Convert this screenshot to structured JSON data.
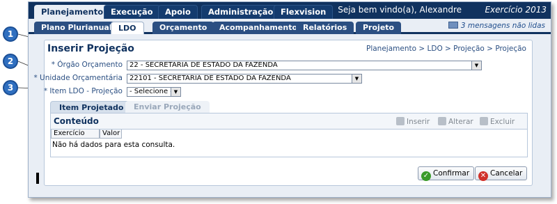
{
  "top_tabs": [
    {
      "label": "Planejamento"
    },
    {
      "label": "Execução"
    },
    {
      "label": "Apoio"
    },
    {
      "label": "Administração"
    },
    {
      "label": "Flexvision"
    }
  ],
  "welcome_text": "Seja bem vindo(a), Alexandre",
  "exercise_text": "Exercício 2013",
  "sub_tabs": [
    {
      "label": "Plano Plurianual"
    },
    {
      "label": "LDO"
    },
    {
      "label": "Orçamento"
    },
    {
      "label": "Acompanhamento"
    },
    {
      "label": "Relatórios"
    },
    {
      "label": "Projeto"
    }
  ],
  "messages_text": "3 mensagens não lidas",
  "panel": {
    "title": "Inserir Projeção",
    "breadcrumb": "Planejamento > LDO > Projeção > Projeção"
  },
  "form": {
    "orgao_label": "* Órgão Orçamento",
    "orgao_value": "22 - SECRETARIA DE ESTADO DA FAZENDA",
    "unidade_label": "* Unidade Orçamentária",
    "unidade_value": "22101 - SECRETARIA DE ESTADO DA FAZENDA",
    "item_label": "* Item LDO - Projeção",
    "item_value": "- Selecione -"
  },
  "inner_tabs": [
    {
      "label": "Item Projetado"
    },
    {
      "label": "Enviar Projeção"
    }
  ],
  "content": {
    "title": "Conteúdo",
    "insert_label": "Inserir",
    "edit_label": "Alterar",
    "delete_label": "Excluir",
    "columns": [
      "Exercício",
      "Valor"
    ],
    "empty_message": "Não há dados para esta consulta."
  },
  "buttons": {
    "confirm_label": "Confirmar",
    "cancel_label": "Cancelar"
  },
  "markers": [
    "1",
    "2",
    "3"
  ],
  "colors": {
    "brand_navy": "#10325f",
    "marker_blue": "#2f6fc0",
    "confirm_green": "#3a9a2a",
    "cancel_red": "#d0302a"
  }
}
